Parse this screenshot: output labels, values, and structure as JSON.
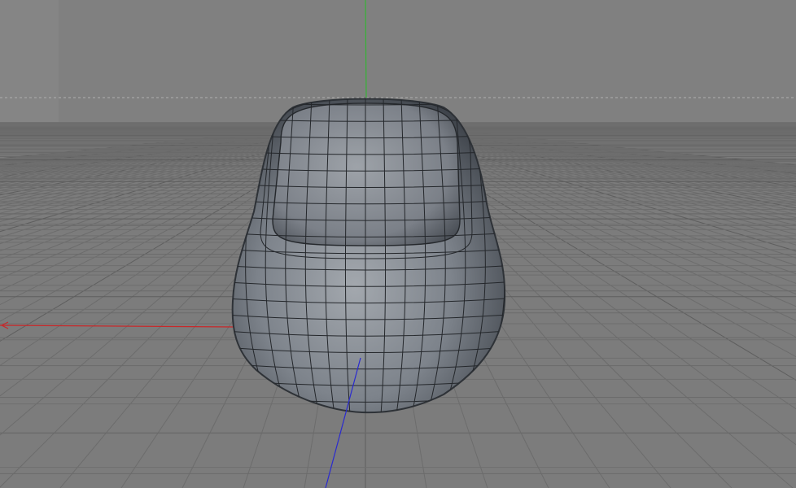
{
  "viewport": {
    "background_color": "#808080",
    "side_strip_color": "#858585",
    "floor_color": "#7a7a7a",
    "grid_line_color": "#6a6a6a",
    "axis_colors": {
      "x": "#c8282a",
      "y": "#35b335",
      "z": "#2a2ad0"
    },
    "object_color": "#8a9098"
  }
}
